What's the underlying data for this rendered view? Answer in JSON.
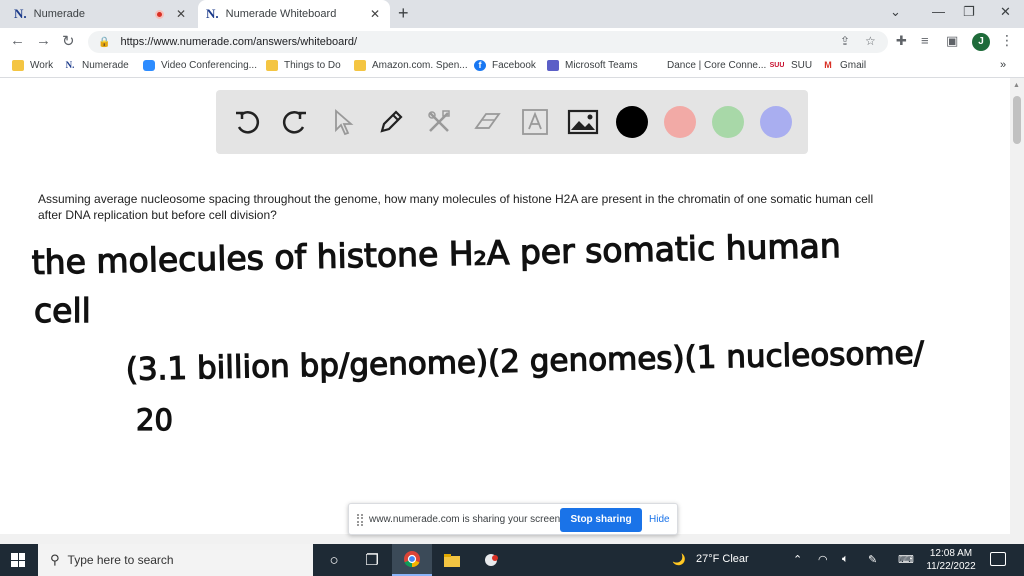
{
  "browser": {
    "tabs": [
      {
        "label": "Numerade",
        "favicon": "N."
      },
      {
        "label": "Numerade Whiteboard",
        "favicon": "N."
      }
    ],
    "url": "https://www.numerade.com/answers/whiteboard/",
    "profile_initial": "J"
  },
  "bookmarks": [
    {
      "label": "Work"
    },
    {
      "label": "Numerade"
    },
    {
      "label": "Video Conferencing..."
    },
    {
      "label": "Things to Do"
    },
    {
      "label": "Amazon.com. Spen..."
    },
    {
      "label": "Facebook"
    },
    {
      "label": "Microsoft Teams"
    },
    {
      "label": "Dance | Core Conne..."
    },
    {
      "label": "SUU",
      "icon_text": "SUU"
    },
    {
      "label": "Gmail"
    }
  ],
  "whiteboard": {
    "colors": [
      "#000000",
      "#f2aaa6",
      "#a8d8a8",
      "#a9aef0"
    ],
    "question": "Assuming average nucleosome spacing throughout the genome, how many molecules of histone H2A are present in the chromatin of one somatic human cell after DNA replication but before cell division?",
    "handwriting": {
      "line1": "the molecules of histone H₂A per somatic human",
      "line2": "cell",
      "line3": "(3.1 billion bp/genome)(2 genomes)(1 nucleosome/",
      "line4": "20"
    }
  },
  "sharebar": {
    "message": "www.numerade.com is sharing your screen.",
    "stop_label": "Stop sharing",
    "hide_label": "Hide"
  },
  "taskbar": {
    "search_placeholder": "Type here to search",
    "weather": "27°F  Clear",
    "time": "12:08 AM",
    "date": "11/22/2022"
  }
}
